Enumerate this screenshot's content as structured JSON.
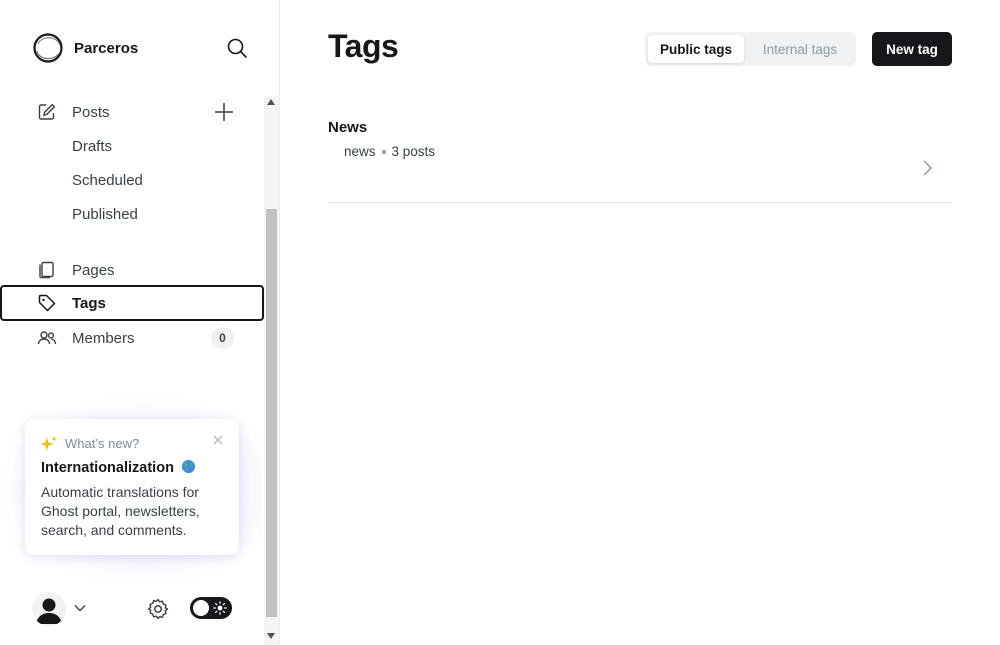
{
  "brand": {
    "name": "Parceros"
  },
  "nav": {
    "posts": "Posts",
    "drafts": "Drafts",
    "scheduled": "Scheduled",
    "published": "Published",
    "pages": "Pages",
    "tags": "Tags",
    "members": "Members",
    "members_count": "0"
  },
  "whats_new": {
    "kicker": "What’s new?",
    "title": "Internationalization",
    "body": "Automatic translations for Ghost portal, newsletters, search, and comments."
  },
  "main": {
    "title": "Tags",
    "seg_public": "Public tags",
    "seg_internal": "Internal tags",
    "new_tag": "New tag"
  },
  "tags": [
    {
      "name": "News",
      "slug": "news",
      "posts": "3 posts"
    }
  ],
  "icons": {
    "search": "search-icon",
    "posts": "pencil-edit-icon",
    "add": "plus-icon",
    "pages": "page-icon",
    "tags": "tag-icon",
    "members": "members-icon",
    "sparkle": "sparkle-icon",
    "globe": "globe-icon",
    "close": "close-icon",
    "settings": "gear-icon",
    "theme": "sun-icon",
    "chevron": "chevron-right-icon"
  },
  "colors": {
    "accent": "#15171a",
    "muted": "#8e9cac",
    "badge_bg": "#eff1f3"
  }
}
